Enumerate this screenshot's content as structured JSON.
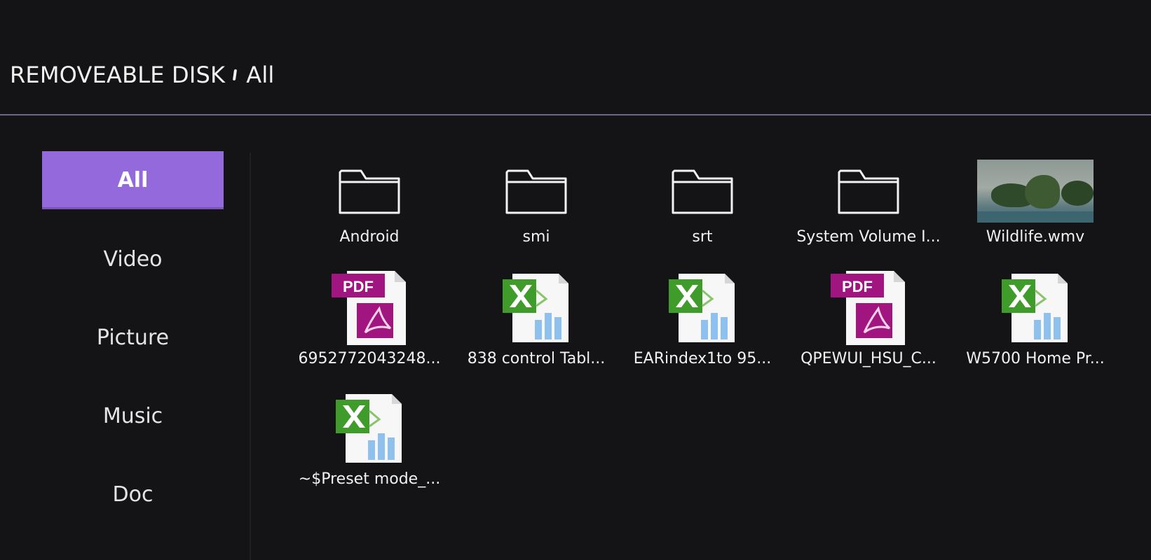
{
  "header": {
    "root": "REMOVEABLE DISK",
    "current": "All"
  },
  "sidebar": {
    "items": [
      {
        "label": "All",
        "active": true
      },
      {
        "label": "Video",
        "active": false
      },
      {
        "label": "Picture",
        "active": false
      },
      {
        "label": "Music",
        "active": false
      },
      {
        "label": "Doc",
        "active": false
      }
    ]
  },
  "files": [
    {
      "name": "Android",
      "type": "folder-icon"
    },
    {
      "name": "smi",
      "type": "folder-icon"
    },
    {
      "name": "srt",
      "type": "folder-icon"
    },
    {
      "name": "System Volume I...",
      "type": "folder-icon"
    },
    {
      "name": "Wildlife.wmv",
      "type": "video-thumbnail"
    },
    {
      "name": "6952772043248...",
      "type": "pdf-file-icon",
      "badge": "PDF"
    },
    {
      "name": "838 control Tabl...",
      "type": "excel-file-icon"
    },
    {
      "name": "EARindex1to 95...",
      "type": "excel-file-icon"
    },
    {
      "name": "QPEWUI_HSU_C...",
      "type": "pdf-file-icon",
      "badge": "PDF"
    },
    {
      "name": "W5700 Home Pr...",
      "type": "excel-file-icon"
    },
    {
      "name": "~$Preset mode_...",
      "type": "excel-file-icon"
    }
  ],
  "colors": {
    "accent": "#9469dc",
    "background": "#141315",
    "divider": "#6c6688",
    "pdf": "#a0157f",
    "excel": "#3f9b2a"
  }
}
